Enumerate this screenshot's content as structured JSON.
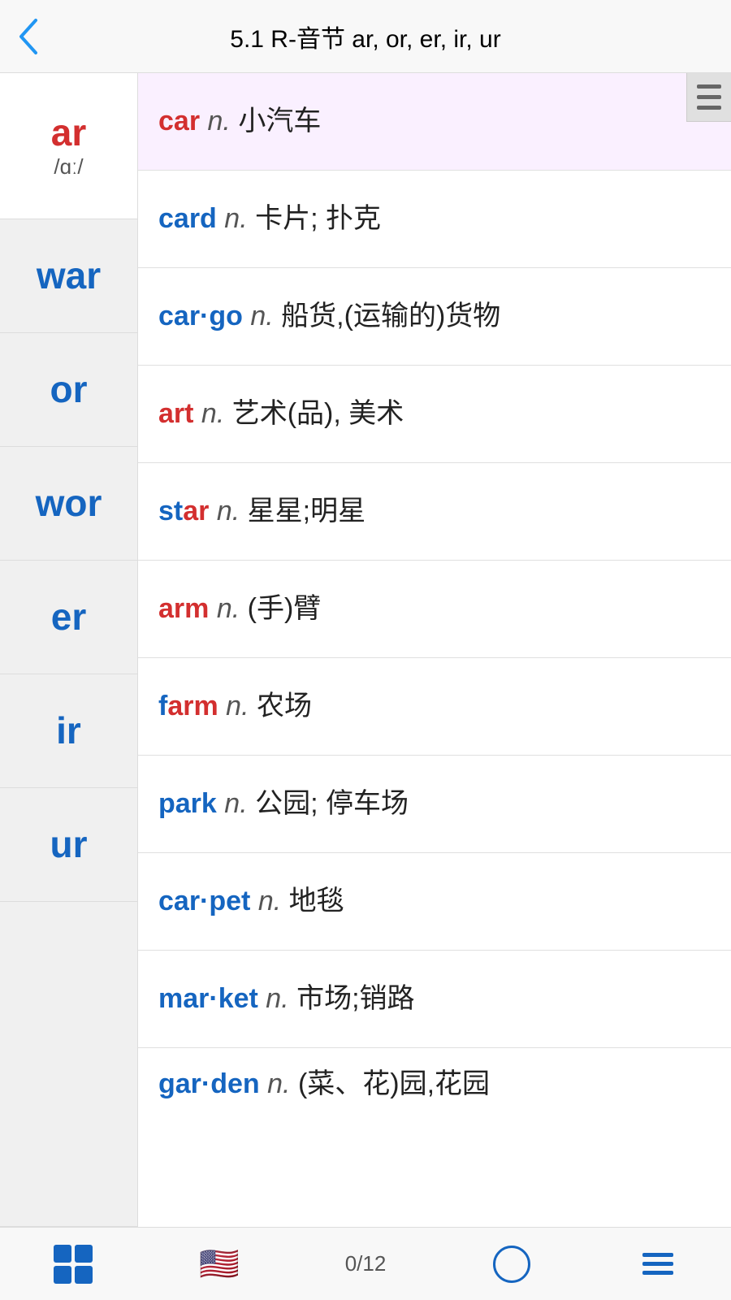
{
  "header": {
    "title": "5.1 R-音节 ar, or, er, ir, ur",
    "back_label": "‹"
  },
  "sidebar": {
    "items": [
      {
        "id": "ar",
        "label": "ar",
        "ipa": "/ɑː/",
        "color": "red"
      },
      {
        "id": "war",
        "label": "war",
        "color": "blue"
      },
      {
        "id": "or",
        "label": "or",
        "color": "blue"
      },
      {
        "id": "wor",
        "label": "wor",
        "color": "blue"
      },
      {
        "id": "er",
        "label": "er",
        "color": "blue"
      },
      {
        "id": "ir",
        "label": "ir",
        "color": "blue"
      },
      {
        "id": "ur",
        "label": "ur",
        "color": "blue"
      }
    ]
  },
  "words": [
    {
      "id": "car",
      "hw_red": "car",
      "hw_blue": "",
      "rest": "",
      "pos": "n.",
      "meaning": "小汽车"
    },
    {
      "id": "card",
      "hw_red": "car",
      "hw_blue": "d",
      "rest": "",
      "pos": "n.",
      "meaning": "卡片; 扑克"
    },
    {
      "id": "cargo",
      "hw_red": "car",
      "hw_blue": "·go",
      "rest": "",
      "pos": "n.",
      "meaning": "船货,(运输的)货物"
    },
    {
      "id": "art",
      "hw_red": "art",
      "hw_blue": "",
      "rest": "",
      "pos": "n.",
      "meaning": "艺术(品), 美术"
    },
    {
      "id": "star",
      "hw_red": "star",
      "hw_blue": "",
      "rest": "",
      "pos": "n.",
      "meaning": "星星;明星"
    },
    {
      "id": "arm",
      "hw_red": "arm",
      "hw_blue": "",
      "rest": "",
      "pos": "n.",
      "meaning": "(手)臂"
    },
    {
      "id": "farm",
      "hw_red": "farm",
      "hw_blue": "",
      "rest": "",
      "pos": "n.",
      "meaning": "农场"
    },
    {
      "id": "park",
      "hw_red": "par",
      "hw_blue": "k",
      "rest": "",
      "pos": "n.",
      "meaning": "公园; 停车场"
    },
    {
      "id": "carpet",
      "hw_red": "car",
      "hw_blue": "·pet",
      "rest": "",
      "pos": "n.",
      "meaning": "地毯"
    },
    {
      "id": "market",
      "hw_red": "mar",
      "hw_blue": "·ket",
      "rest": "",
      "pos": "n.",
      "meaning": "市场;销路"
    },
    {
      "id": "garden",
      "hw_red": "gar",
      "hw_blue": "·den",
      "rest": "",
      "pos": "n.",
      "meaning": "(菜、花)园,花园"
    }
  ],
  "bottom_nav": {
    "page_count": "0/12"
  }
}
